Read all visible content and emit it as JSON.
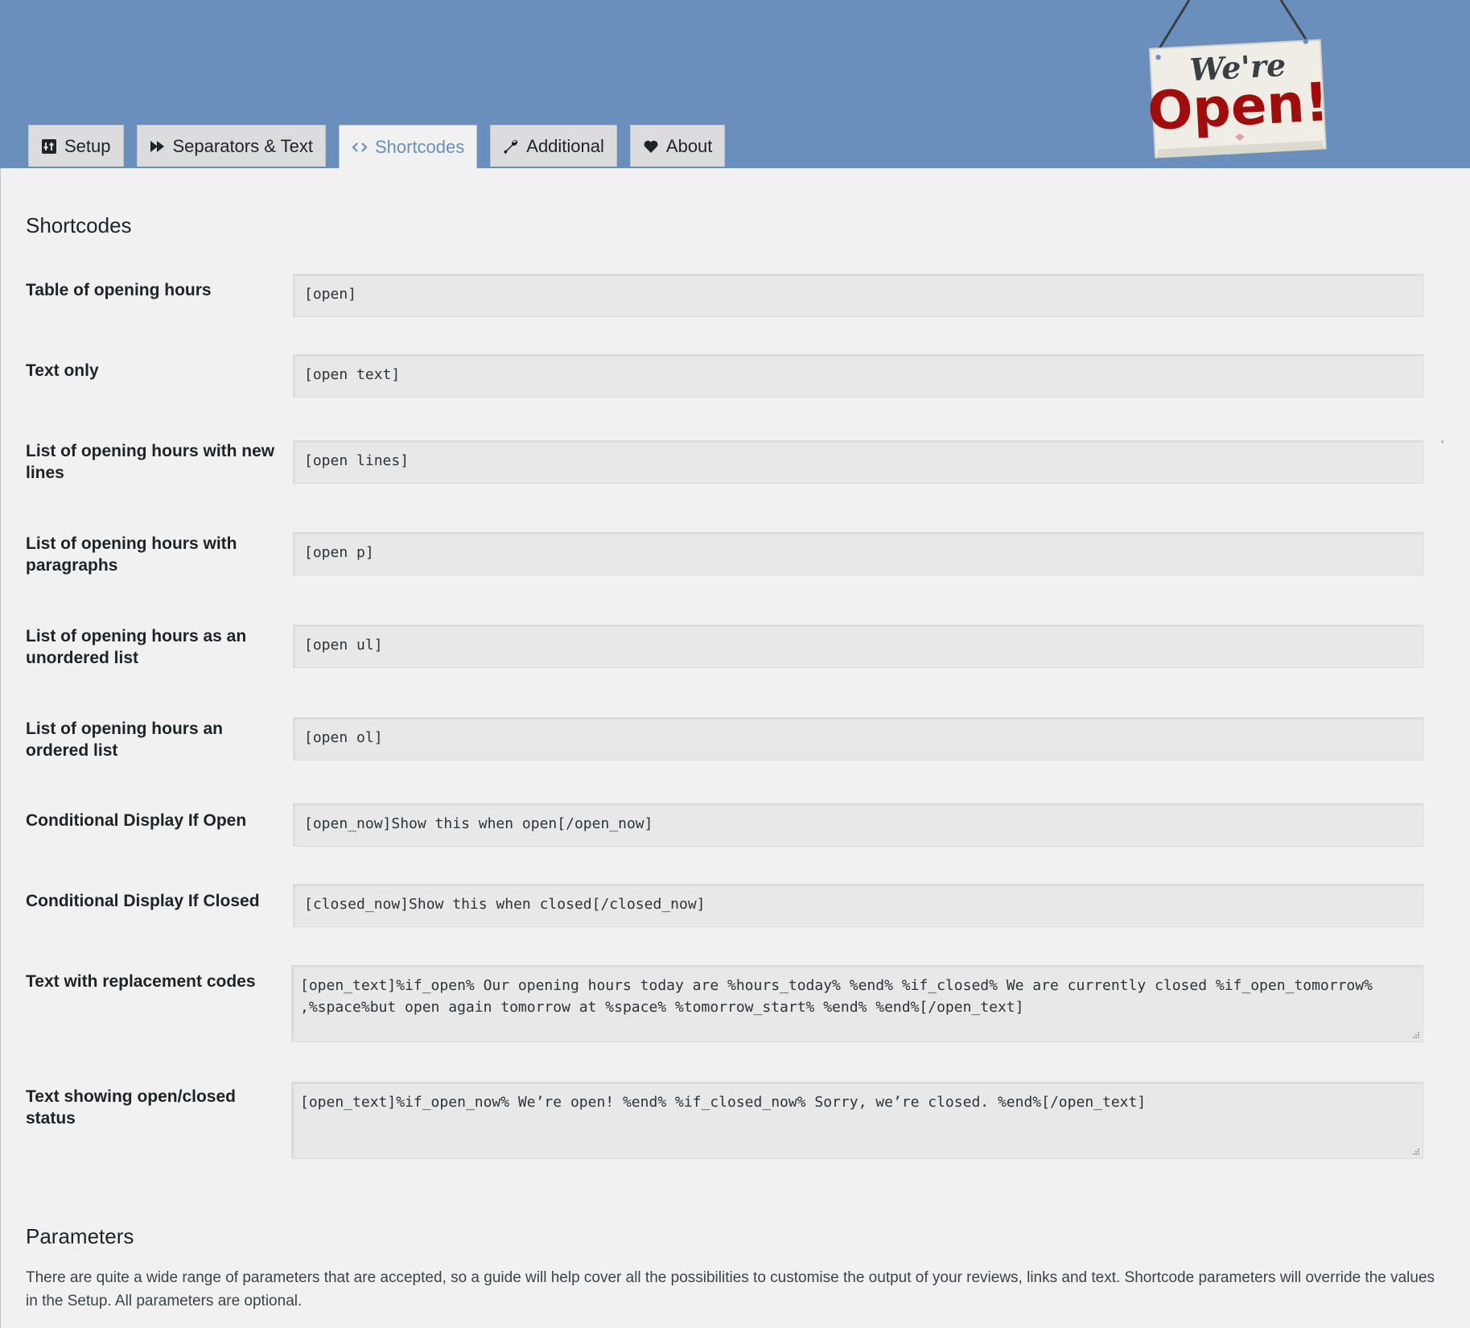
{
  "tabs": [
    {
      "label": "Setup",
      "icon": "setup-icon"
    },
    {
      "label": "Separators & Text",
      "icon": "fast-forward-icon"
    },
    {
      "label": "Shortcodes",
      "icon": "code-icon",
      "active": true
    },
    {
      "label": "Additional",
      "icon": "wrench-icon"
    },
    {
      "label": "About",
      "icon": "heart-icon"
    }
  ],
  "sign": {
    "line1": "We're",
    "line2": "Open!"
  },
  "section_title": "Shortcodes",
  "rows": [
    {
      "label": "Table of opening hours",
      "value": "[open]"
    },
    {
      "label": "Text only",
      "value": "[open text]"
    },
    {
      "label": "List of opening hours with new lines",
      "value": "[open lines]"
    },
    {
      "label": "List of opening hours with paragraphs",
      "value": "[open p]"
    },
    {
      "label": "List of opening hours as an unordered list",
      "value": "[open ul]"
    },
    {
      "label": "List of opening hours an ordered list",
      "value": "[open ol]"
    },
    {
      "label": "Conditional Display If Open",
      "value": "[open_now]Show this when open[/open_now]"
    },
    {
      "label": "Conditional Display If Closed",
      "value": "[closed_now]Show this when closed[/closed_now]"
    },
    {
      "label": "Text with replacement codes",
      "value": "[open_text]%if_open% Our opening hours today are %hours_today% %end% %if_closed% We are currently closed %if_open_tomorrow% ,%space%but open again tomorrow at %space% %tomorrow_start% %end% %end%[/open_text]"
    },
    {
      "label": "Text showing open/closed status",
      "value": "[open_text]%if_open_now% We’re open! %end% %if_closed_now% Sorry, we’re closed. %end%[/open_text]"
    }
  ],
  "right_mark": "’",
  "parameters": {
    "title": "Parameters",
    "description": "There are quite a wide range of parameters that are accepted, so a guide will help cover all the possibilities to customise the output of your reviews, links and text. Shortcode parameters will override the values in the Setup. All parameters are optional."
  },
  "colors": {
    "header": "#6a8fbc",
    "active_tab_text": "#6a8fbc",
    "sign_red": "#a10d0d"
  }
}
